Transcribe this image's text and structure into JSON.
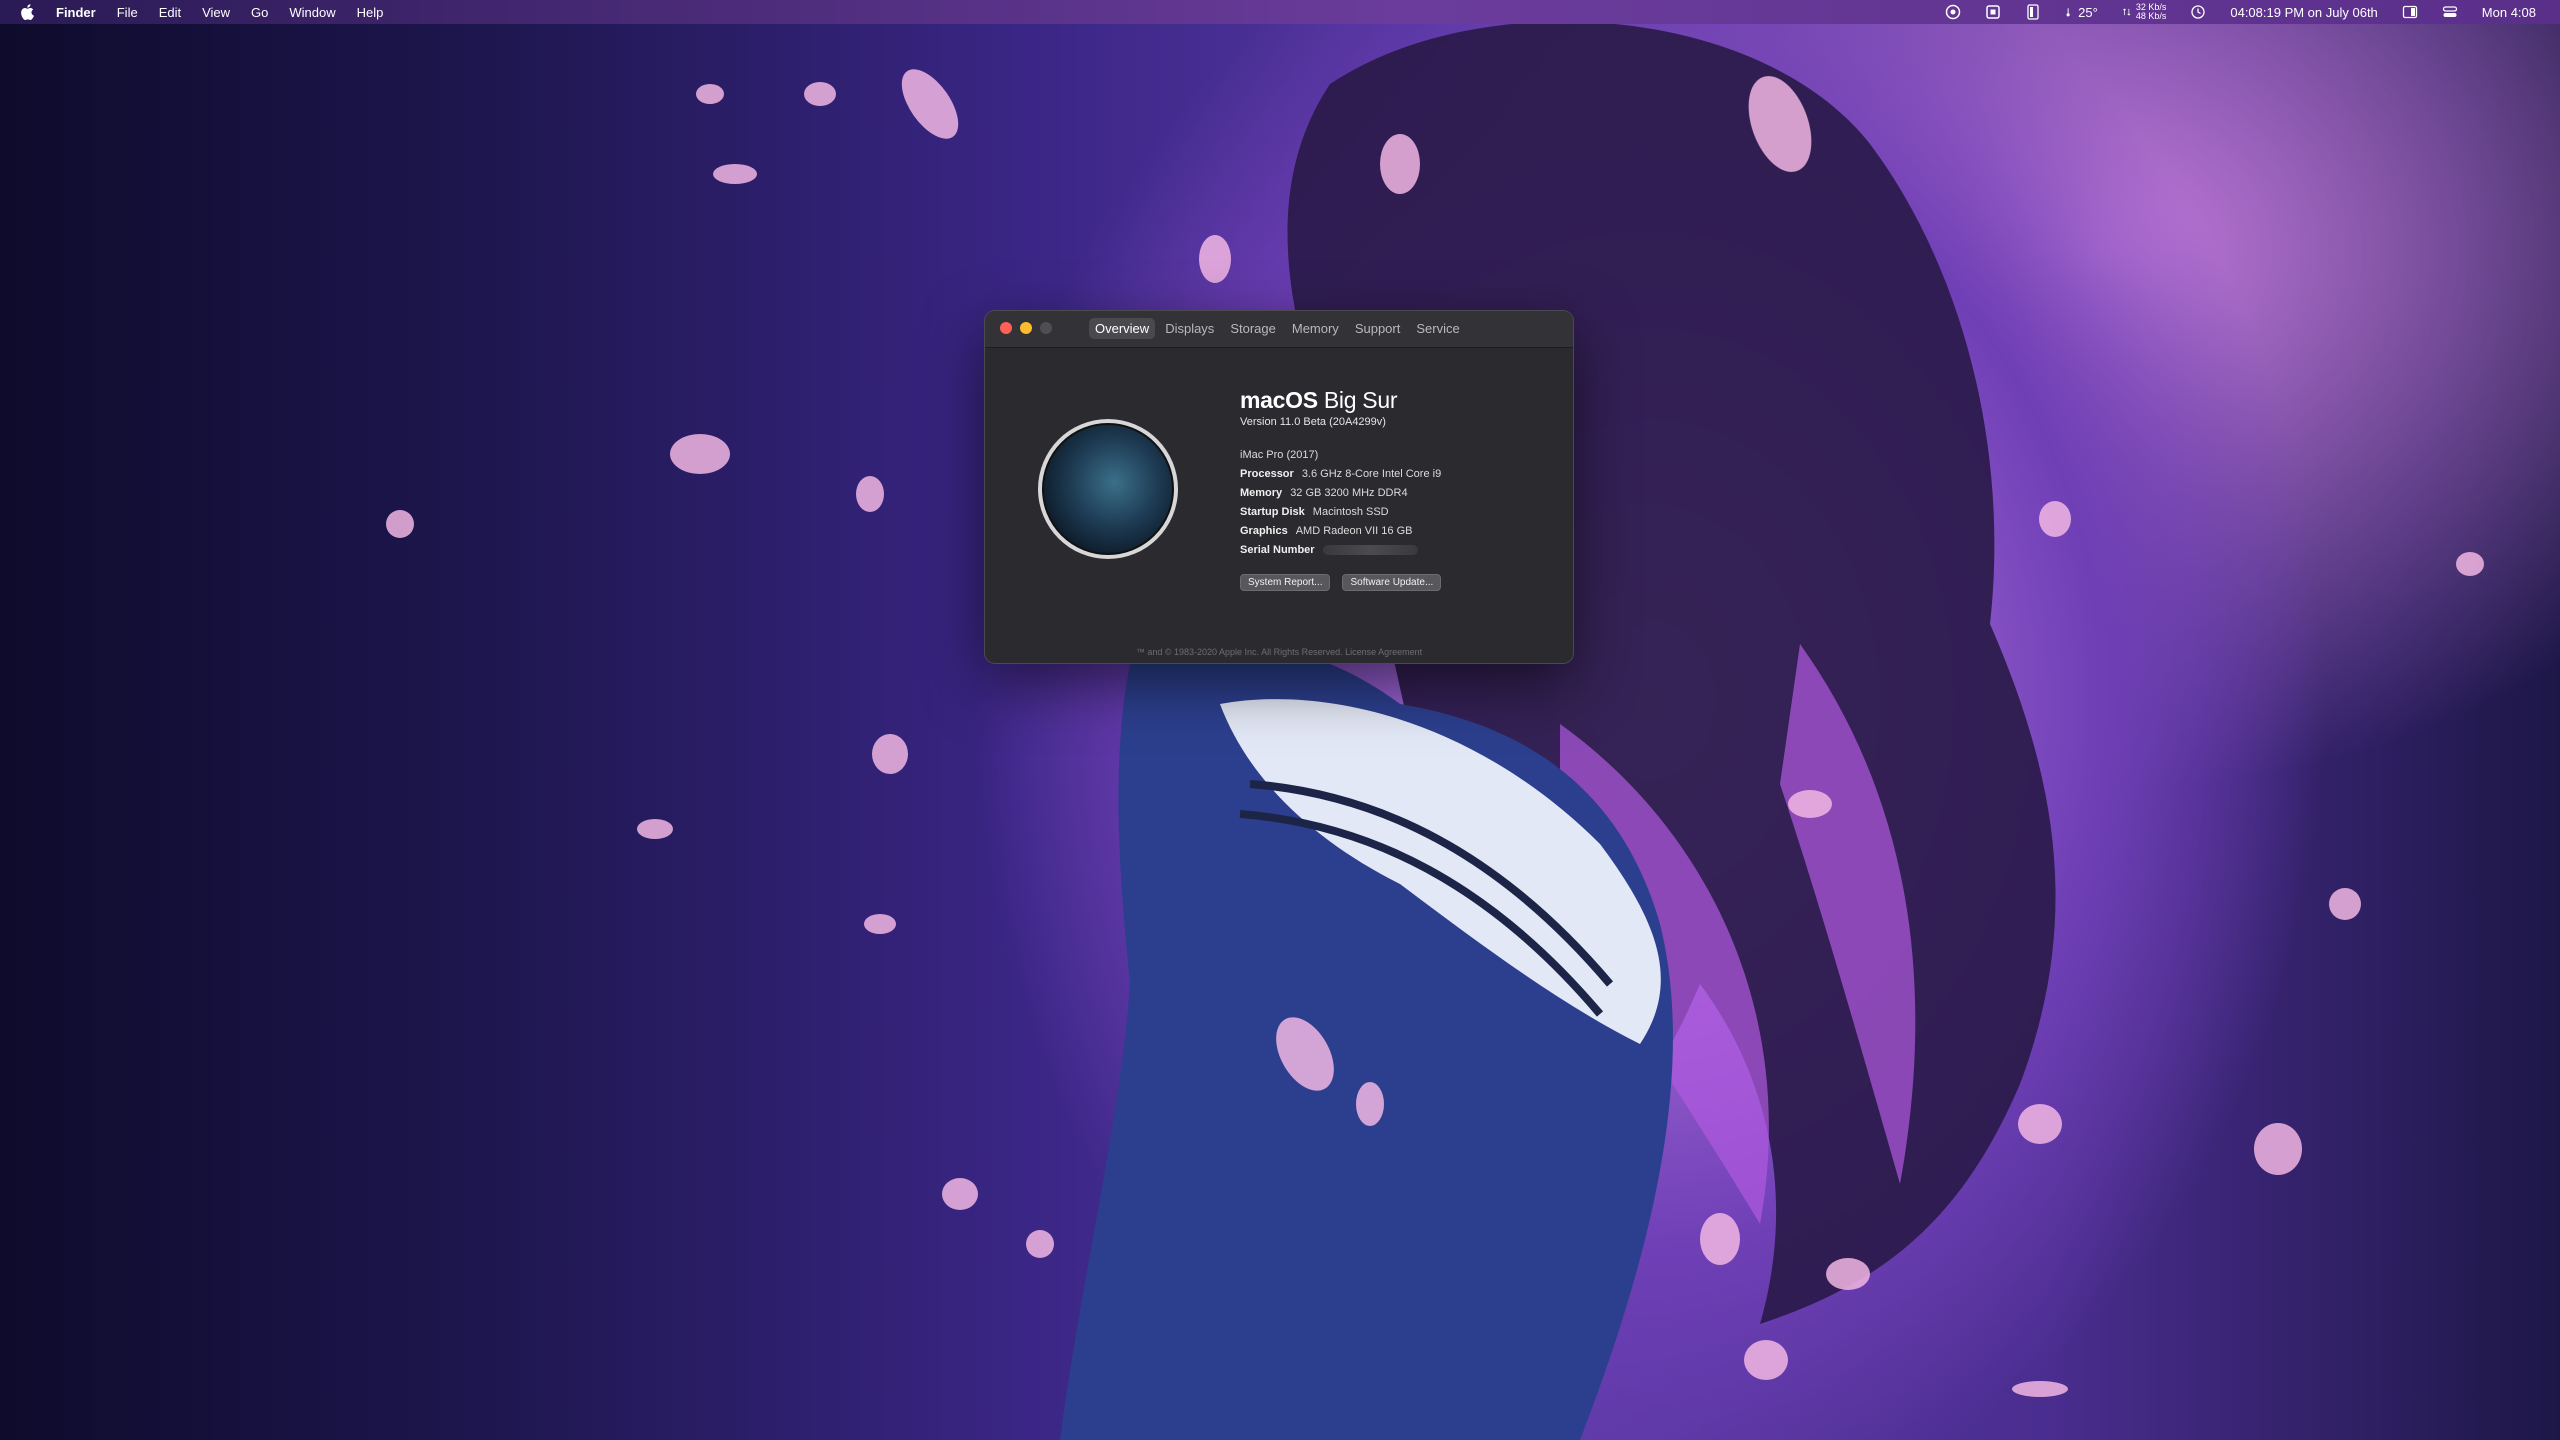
{
  "menubar": {
    "app_name": "Finder",
    "menus": [
      "File",
      "Edit",
      "View",
      "Go",
      "Window",
      "Help"
    ],
    "status": {
      "weather": "25°",
      "net_up": "32 Kb/s",
      "net_down": "48 Kb/s",
      "datetime": "04:08:19 PM on July 06th",
      "clock": "Mon 4:08"
    },
    "icons": [
      "apple-icon",
      "status-ring-icon",
      "stop-icon",
      "battery-icon",
      "weather-icon",
      "network-icon",
      "time-machine-icon",
      "sidebar-icon",
      "control-center-icon"
    ]
  },
  "window": {
    "tabs": [
      "Overview",
      "Displays",
      "Storage",
      "Memory",
      "Support",
      "Service"
    ],
    "active_tab": "Overview",
    "os_name_bold": "macOS",
    "os_name_rest": "Big Sur",
    "version": "Version 11.0 Beta (20A4299v)",
    "model": "iMac Pro (2017)",
    "specs": [
      {
        "label": "Processor",
        "value": "3.6 GHz 8-Core Intel Core i9"
      },
      {
        "label": "Memory",
        "value": "32 GB 3200 MHz DDR4"
      },
      {
        "label": "Startup Disk",
        "value": "Macintosh SSD"
      },
      {
        "label": "Graphics",
        "value": "AMD Radeon VII 16 GB"
      }
    ],
    "serial_label": "Serial Number",
    "buttons": {
      "system_report": "System Report...",
      "software_update": "Software Update..."
    },
    "footer": "™ and © 1983-2020 Apple Inc. All Rights Reserved. License Agreement"
  },
  "colors": {
    "close": "#fe5f57",
    "minimize": "#febc2e",
    "window_bg": "#2b2a2e"
  }
}
